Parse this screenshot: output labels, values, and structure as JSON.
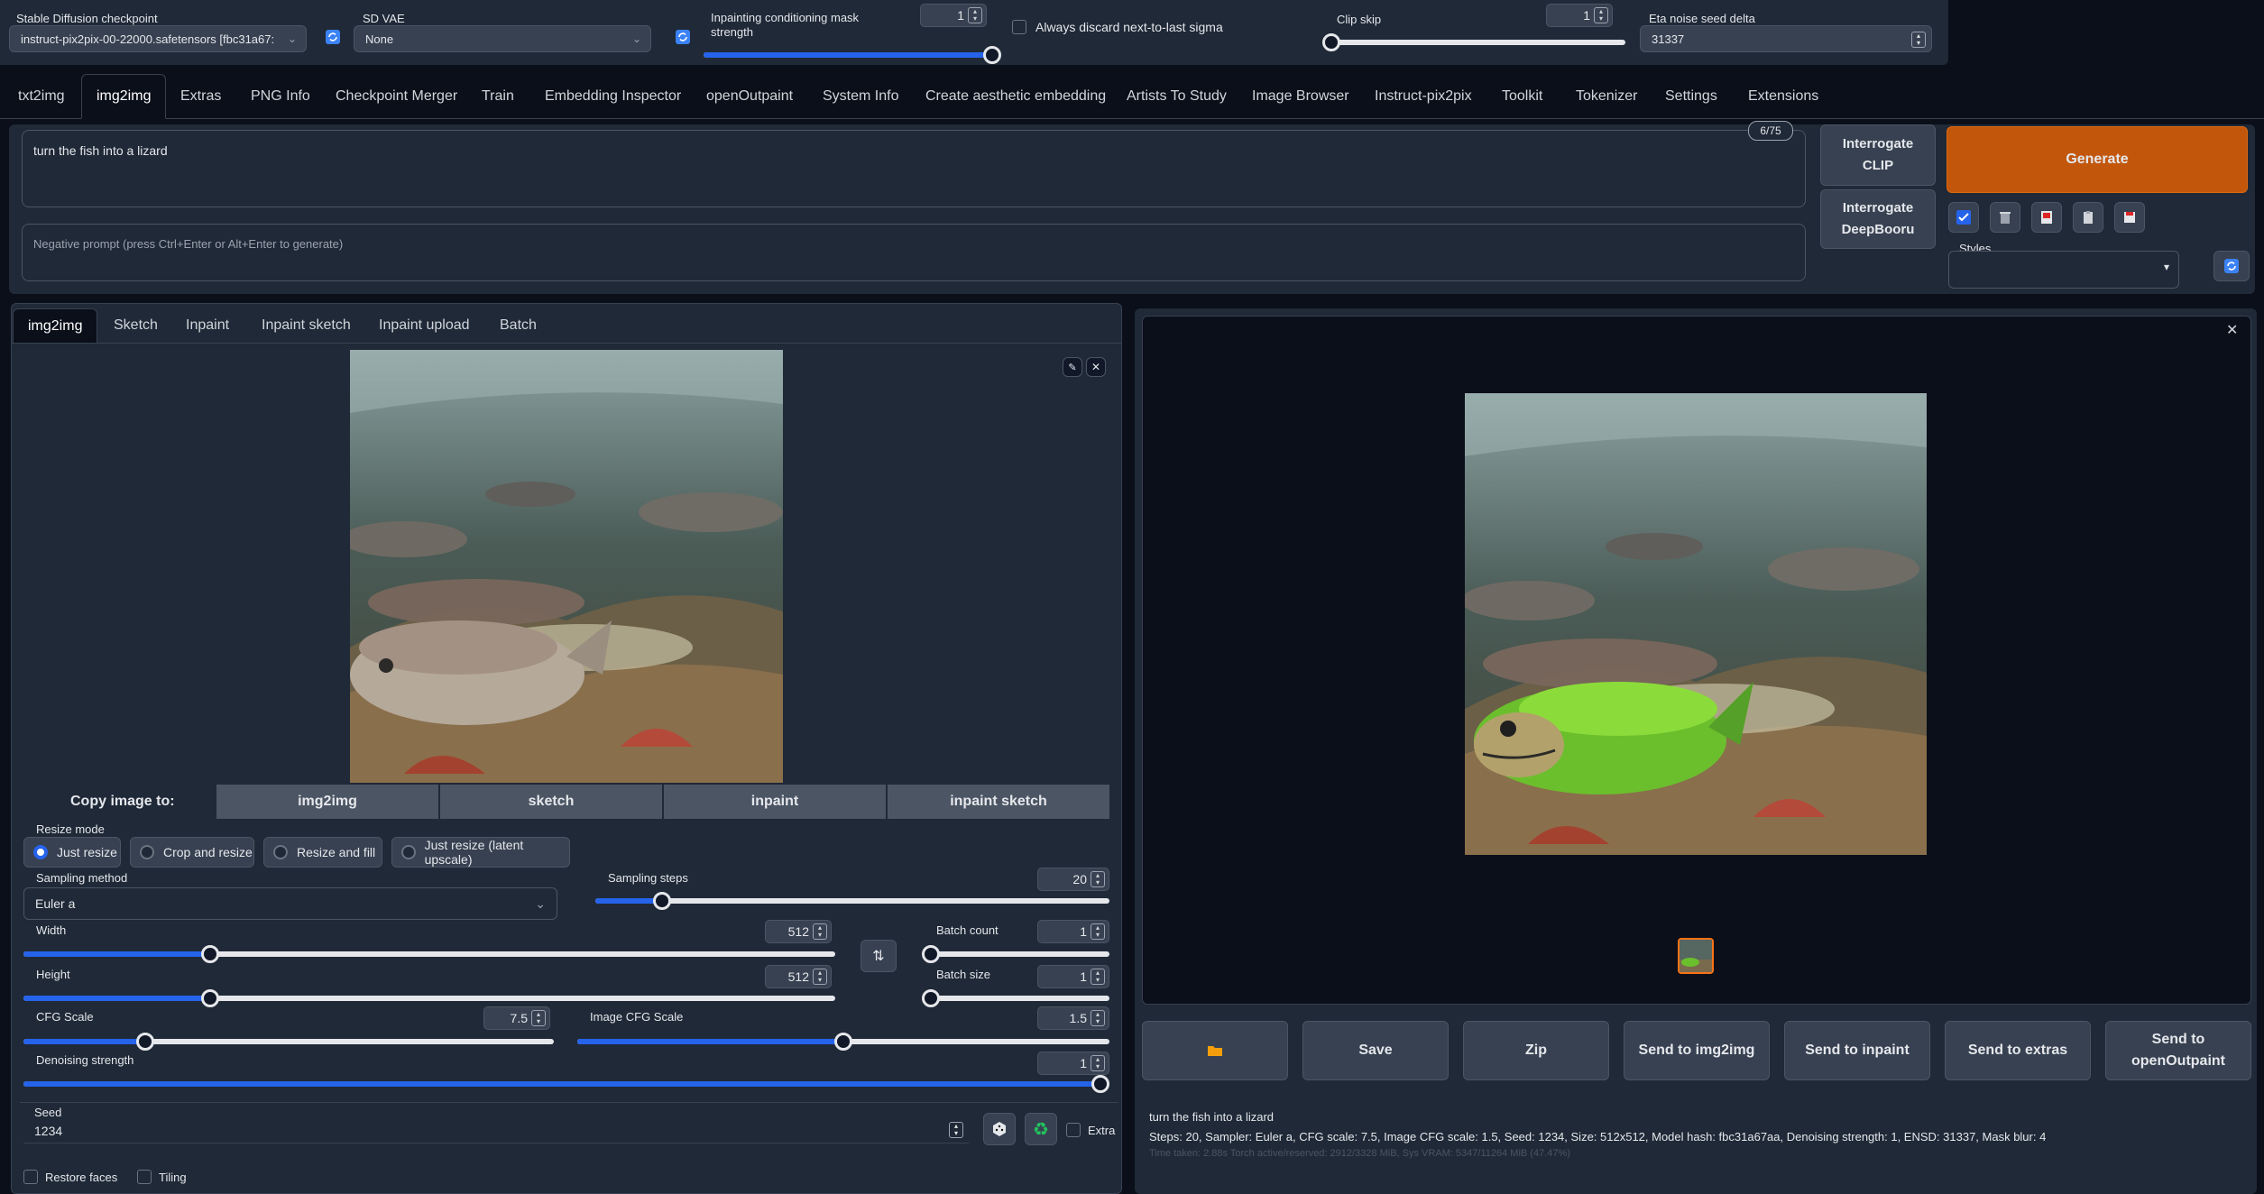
{
  "top": {
    "checkpoint_label": "Stable Diffusion checkpoint",
    "checkpoint_value": "instruct-pix2pix-00-22000.safetensors [fbc31a67:",
    "vae_label": "SD VAE",
    "vae_value": "None",
    "mask_label": "Inpainting conditioning mask strength",
    "mask_value": "1",
    "mask_level": 1.0,
    "discard_label": "Always discard next-to-last sigma",
    "clip_label": "Clip skip",
    "clip_value": "1",
    "clip_level": 0.0,
    "eta_label": "Eta noise seed delta",
    "eta_value": "31337"
  },
  "tabs": [
    "txt2img",
    "img2img",
    "Extras",
    "PNG Info",
    "Checkpoint Merger",
    "Train",
    "Embedding Inspector",
    "openOutpaint",
    "System Info",
    "Create aesthetic embedding",
    "Artists To Study",
    "Image Browser",
    "Instruct-pix2pix",
    "Toolkit",
    "Tokenizer",
    "Settings",
    "Extensions"
  ],
  "active_tab": "img2img",
  "prompt": {
    "text": "turn the fish into a lizard",
    "token_count": "6/75",
    "negative_placeholder": "Negative prompt (press Ctrl+Enter or Alt+Enter to generate)"
  },
  "actions": {
    "interrogate_clip": "Interrogate CLIP",
    "interrogate_deepbooru": "Interrogate DeepBooru",
    "generate": "Generate",
    "styles_label": "Styles"
  },
  "subtabs": [
    "img2img",
    "Sketch",
    "Inpaint",
    "Inpaint sketch",
    "Inpaint upload",
    "Batch"
  ],
  "copy": {
    "label": "Copy image to:",
    "buttons": [
      "img2img",
      "sketch",
      "inpaint",
      "inpaint sketch"
    ]
  },
  "resize": {
    "label": "Resize mode",
    "options": [
      "Just resize",
      "Crop and resize",
      "Resize and fill",
      "Just resize (latent upscale)"
    ],
    "selected": "Just resize"
  },
  "sampling": {
    "method_label": "Sampling method",
    "method_value": "Euler a",
    "steps_label": "Sampling steps",
    "steps_value": "20",
    "steps_level": 0.13
  },
  "dims": {
    "width_label": "Width",
    "width_value": "512",
    "width_level": 0.23,
    "height_label": "Height",
    "height_value": "512",
    "height_level": 0.23,
    "batch_count_label": "Batch count",
    "batch_count_value": "1",
    "batch_count_level": 0.0,
    "batch_size_label": "Batch size",
    "batch_size_value": "1",
    "batch_size_level": 0.0
  },
  "cfg": {
    "cfg_label": "CFG Scale",
    "cfg_value": "7.5",
    "cfg_level": 0.23,
    "img_cfg_label": "Image CFG Scale",
    "img_cfg_value": "1.5",
    "img_cfg_level": 0.5,
    "denoise_label": "Denoising strength",
    "denoise_value": "1",
    "denoise_level": 1.0
  },
  "seed": {
    "label": "Seed",
    "value": "1234",
    "extra_label": "Extra"
  },
  "options": {
    "restore_faces": "Restore faces",
    "tiling": "Tiling"
  },
  "output_buttons": [
    "Save",
    "Zip",
    "Send to img2img",
    "Send to inpaint",
    "Send to extras",
    "Send to openOutpaint"
  ],
  "info": {
    "prompt": "turn the fish into a lizard",
    "params": "Steps: 20, Sampler: Euler a, CFG scale: 7.5, Image CFG scale: 1.5, Seed: 1234, Size: 512x512, Model hash: fbc31a67aa, Denoising strength: 1, ENSD: 31337, Mask blur: 4",
    "timing": "Time taken: 2.88s  Torch active/reserved: 2912/3328 MiB, Sys VRAM: 5347/11264 MiB (47.47%)"
  },
  "colors": {
    "accent": "#2563eb",
    "generate": "#c2570c",
    "background": "#0b0f19",
    "panel": "#1f2937"
  }
}
